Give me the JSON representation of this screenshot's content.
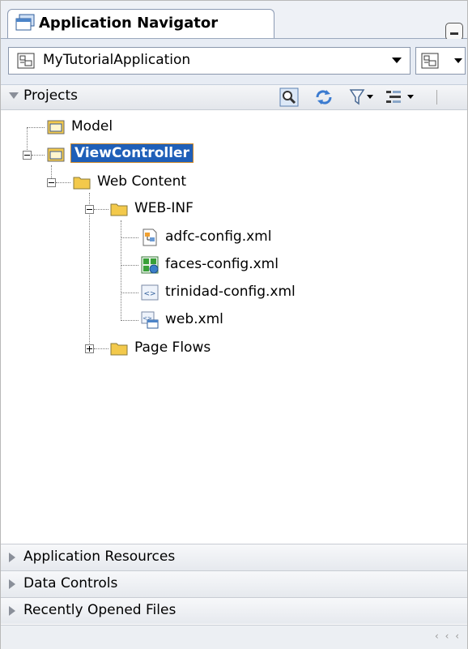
{
  "window": {
    "title": "Application Navigator"
  },
  "app_selector": {
    "value": "MyTutorialApplication"
  },
  "projects": {
    "label": "Projects"
  },
  "tree": {
    "model": "Model",
    "view_controller": "ViewController",
    "web_content": "Web Content",
    "web_inf": "WEB-INF",
    "adfc_config": "adfc-config.xml",
    "faces_config": "faces-config.xml",
    "trinidad_config": "trinidad-config.xml",
    "web_xml": "web.xml",
    "page_flows": "Page Flows"
  },
  "accordion": {
    "application_resources": "Application Resources",
    "data_controls": "Data Controls",
    "recently_opened_files": "Recently Opened Files"
  },
  "status": {
    "chevrons": "‹ ‹ ‹"
  },
  "colors": {
    "selection": "#1f5fb8",
    "folder": "#f3c94b",
    "accent_border": "#d08a2a"
  }
}
